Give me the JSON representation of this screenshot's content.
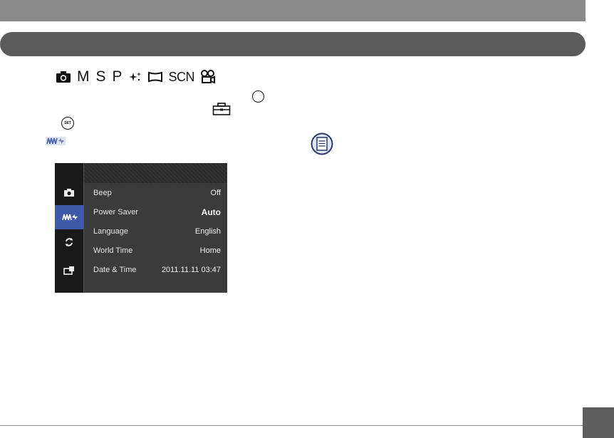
{
  "mode_icons": {
    "items": [
      "camera-icon",
      "M",
      "S",
      "P",
      "sparkle-icon",
      "panorama-icon",
      "SCN",
      "movie-icon"
    ],
    "m_label": "M",
    "s_label": "S",
    "p_label": "P",
    "scn_label": "SCN"
  },
  "set_button": {
    "label": "SET"
  },
  "camera_screen": {
    "sidebar": [
      {
        "icon": "camera-icon",
        "active": false
      },
      {
        "icon": "power-saver-icon",
        "active": true
      },
      {
        "icon": "refresh-icon",
        "active": false
      },
      {
        "icon": "toolbox-icon",
        "active": false
      }
    ],
    "menu": [
      {
        "label": "Beep",
        "value": "Off"
      },
      {
        "label": "Power Saver",
        "value": "Auto"
      },
      {
        "label": "Language",
        "value": "English"
      },
      {
        "label": "World Time",
        "value": "Home"
      },
      {
        "label": "Date & Time",
        "value": "2011.11.11 03:47"
      }
    ],
    "selected_index": 1
  },
  "colors": {
    "band": "#8a8a8a",
    "pill": "#5b5b5b",
    "screen_bg": "#3b3b3b",
    "accent": "#3d5aa8"
  }
}
